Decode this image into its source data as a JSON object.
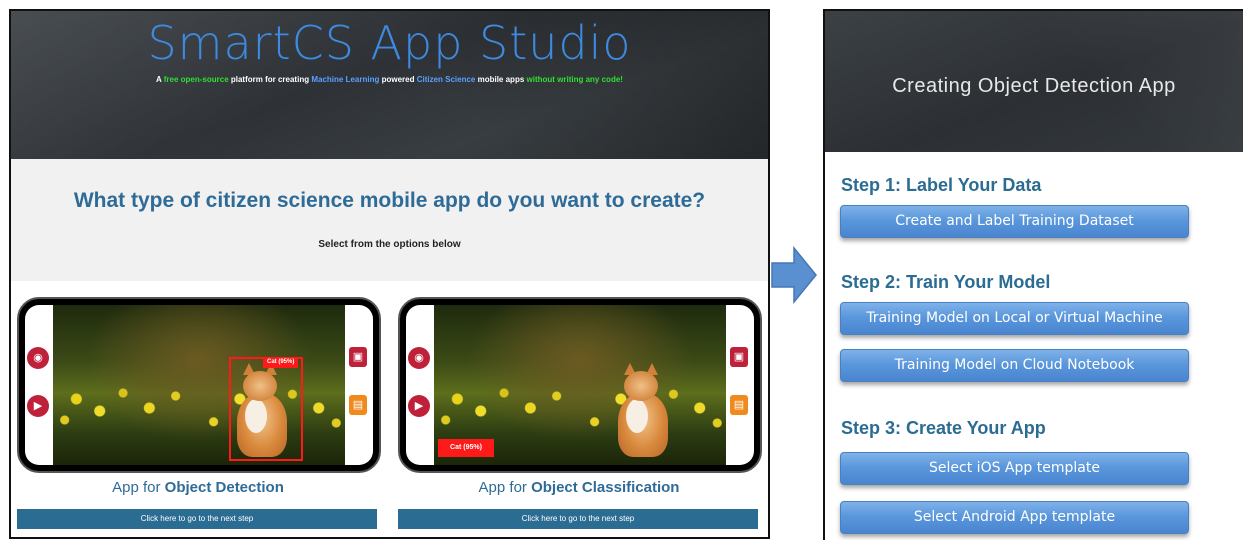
{
  "left": {
    "title": "SmartCS App Studio",
    "subtitle": {
      "p1": "A ",
      "p2": "free open-source",
      "p3": " platform for creating ",
      "p4": "Machine Learning",
      "p5": " powered ",
      "p6": "Citizen Science",
      "p7": " mobile apps ",
      "p8": "without writing any code!"
    },
    "question": "What type of citizen science mobile app do you want to create?",
    "question_sub": "Select from the options below",
    "cards": [
      {
        "caption_prefix": "App for ",
        "caption_bold": "Object Detection",
        "detection_label": "Cat (95%)",
        "button": "Click here to go to the next step"
      },
      {
        "caption_prefix": "App for ",
        "caption_bold": "Object Classification",
        "classification_label": "Cat (95%)",
        "button": "Click here to go to the next step"
      }
    ],
    "icons": {
      "camera": "camera-icon",
      "video": "video-camera-icon",
      "save": "save-icon",
      "document": "document-icon"
    }
  },
  "right": {
    "title": "Creating Object Detection App",
    "step1": {
      "title": "Step 1: Label Your Data",
      "buttons": [
        "Create and Label Training Dataset"
      ]
    },
    "step2": {
      "title": "Step 2: Train Your Model",
      "buttons": [
        "Training Model on Local or Virtual Machine",
        "Training Model on Cloud Notebook"
      ]
    },
    "step3": {
      "title": "Step 3: Create Your App",
      "buttons": [
        "Select iOS App template",
        "Select Android App template"
      ]
    }
  },
  "colors": {
    "accent_blue": "#2f6b97",
    "title_blue": "#3d8ae0",
    "highlight_green": "#33dd33",
    "detection_red": "#ff1a1a",
    "step_button": "#5b97dc"
  }
}
